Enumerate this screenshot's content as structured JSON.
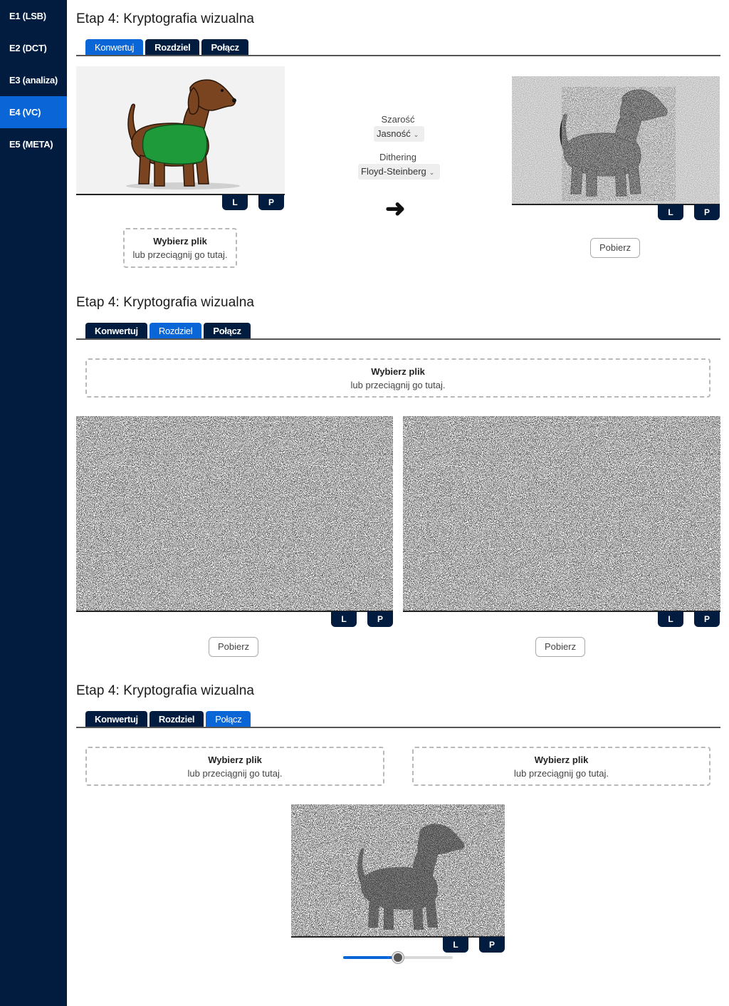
{
  "sidebar": {
    "items": [
      {
        "label": "E1 (LSB)"
      },
      {
        "label": "E2 (DCT)"
      },
      {
        "label": "E3 (analiza)"
      },
      {
        "label": "E4 (VC)"
      },
      {
        "label": "E5 (META)"
      }
    ],
    "active_index": 3
  },
  "colors": {
    "sidebar_bg": "#021c40",
    "accent": "#0a66d6"
  },
  "sections": [
    {
      "title": "Etap 4: Kryptografia wizualna",
      "tabs": [
        "Konwertuj",
        "Rozdziel",
        "Połącz"
      ],
      "active_tab": 0
    },
    {
      "title": "Etap 4: Kryptografia wizualna",
      "tabs": [
        "Konwertuj",
        "Rozdziel",
        "Połącz"
      ],
      "active_tab": 1
    },
    {
      "title": "Etap 4: Kryptografia wizualna",
      "tabs": [
        "Konwertuj",
        "Rozdziel",
        "Połącz"
      ],
      "active_tab": 2
    }
  ],
  "convert": {
    "grayscale_label": "Szarość",
    "grayscale_value": "Jasność",
    "dithering_label": "Dithering",
    "dithering_value": "Floyd-Steinberg",
    "arrow_icon": "arrow-right-icon"
  },
  "dropzone": {
    "title": "Wybierz plik",
    "subtitle": "lub przeciągnij go tutaj."
  },
  "buttons": {
    "download": "Pobierz",
    "left": "L",
    "right": "P"
  },
  "combine": {
    "slider_value_fraction": 0.5
  }
}
